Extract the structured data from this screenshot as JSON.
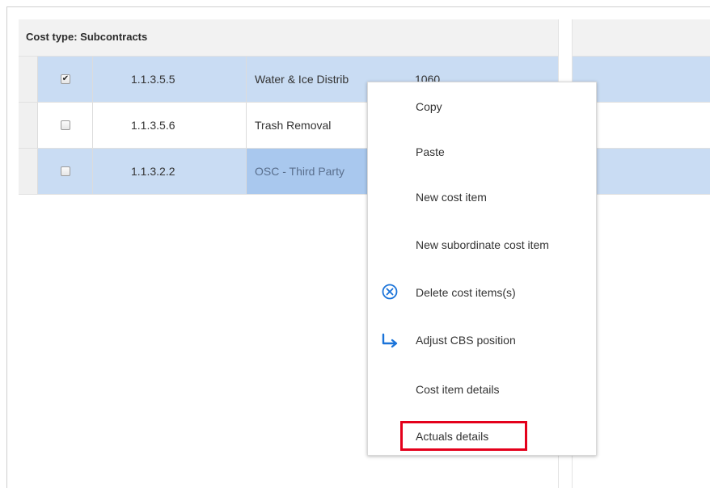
{
  "grid": {
    "header_title": "Cost type: Subcontracts",
    "rows": [
      {
        "checked": "✔",
        "code": "1.1.3.5.5",
        "description": "Water & Ice Distrib",
        "value": "1060"
      },
      {
        "checked": "",
        "code": "1.1.3.5.6",
        "description": "Trash Removal",
        "value": ""
      },
      {
        "checked": "",
        "code": "1.1.3.2.2",
        "description": "OSC - Third Party",
        "value": ""
      }
    ]
  },
  "context_menu": {
    "items": [
      {
        "label": "Copy",
        "icon": ""
      },
      {
        "label": "Paste",
        "icon": ""
      },
      {
        "label": "New cost item",
        "icon": ""
      },
      {
        "label": "New subordinate cost item",
        "icon": ""
      },
      {
        "label": "Delete cost items(s)",
        "icon": "delete-circle-x-icon"
      },
      {
        "label": "Adjust CBS position",
        "icon": "move-right-arrow-icon"
      },
      {
        "label": "Cost item details",
        "icon": ""
      },
      {
        "label": "Actuals details",
        "icon": ""
      }
    ],
    "highlighted_item": "Actuals details"
  },
  "colors": {
    "selected_row": "#c9dcf3",
    "active_cell": "#a9c8ee",
    "highlight_border": "#e4001b",
    "icon_blue": "#1a73d9"
  }
}
